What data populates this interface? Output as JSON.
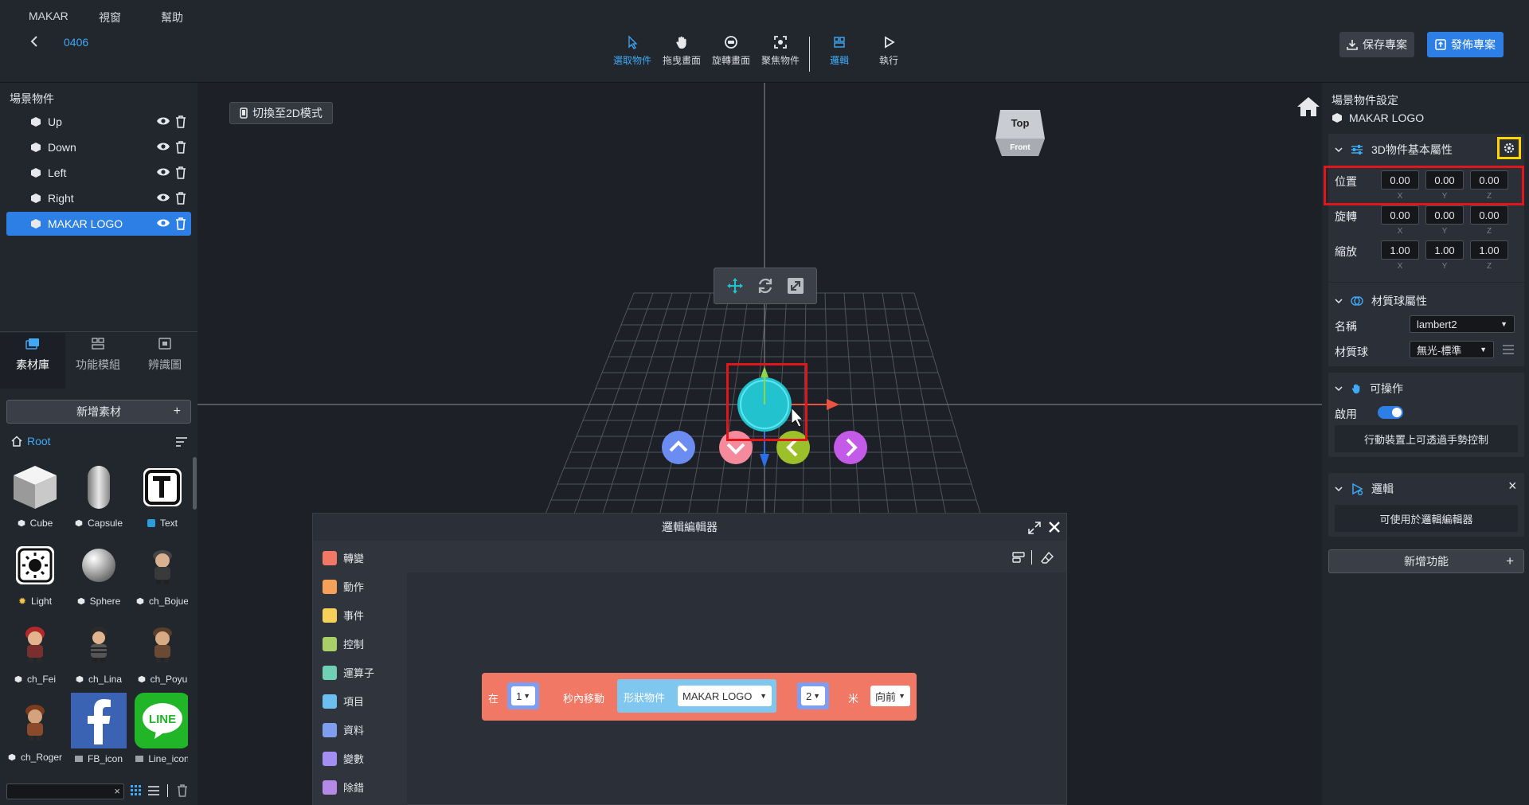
{
  "menu": {
    "app": "MAKAR",
    "window": "視窗",
    "help": "幫助"
  },
  "project": {
    "name": "0406"
  },
  "toolbar": {
    "tools": [
      {
        "label": "選取物件",
        "icon": "cursor-icon",
        "active": true
      },
      {
        "label": "拖曳畫面",
        "icon": "hand-icon",
        "active": false
      },
      {
        "label": "旋轉畫面",
        "icon": "rotate-view-icon",
        "active": false
      },
      {
        "label": "聚焦物件",
        "icon": "focus-icon",
        "active": false
      },
      {
        "label": "邏輯",
        "icon": "logic-icon",
        "active": true
      },
      {
        "label": "執行",
        "icon": "play-icon",
        "active": false
      }
    ],
    "save_label": "保存專案",
    "publish_label": "發佈專案"
  },
  "scene": {
    "title": "場景物件",
    "items": [
      {
        "label": "Up",
        "selected": false
      },
      {
        "label": "Down",
        "selected": false
      },
      {
        "label": "Left",
        "selected": false
      },
      {
        "label": "Right",
        "selected": false
      },
      {
        "label": "MAKAR LOGO",
        "selected": true
      }
    ]
  },
  "library": {
    "tabs": [
      {
        "label": "素材庫",
        "active": true
      },
      {
        "label": "功能模組",
        "active": false
      },
      {
        "label": "辨識圖",
        "active": false
      }
    ],
    "add_label": "新增素材",
    "add_symbol": "+",
    "root_label": "Root",
    "search_clear": "×",
    "assets": [
      {
        "label": "Cube"
      },
      {
        "label": "Capsule"
      },
      {
        "label": "Text"
      },
      {
        "label": "Light"
      },
      {
        "label": "Sphere"
      },
      {
        "label": "ch_Bojue"
      },
      {
        "label": "ch_Fei"
      },
      {
        "label": "ch_Lina"
      },
      {
        "label": "ch_Poyu"
      },
      {
        "label": "ch_Roger"
      },
      {
        "label": "FB_icon"
      },
      {
        "label": "Line_icon"
      }
    ]
  },
  "viewport": {
    "mode_button": "切換至2D模式",
    "gizmo_top": "Top",
    "gizmo_front": "Front"
  },
  "logic_editor": {
    "title": "邏輯編輯器",
    "categories": [
      {
        "label": "轉變",
        "color": "#f07865"
      },
      {
        "label": "動作",
        "color": "#f5a15a"
      },
      {
        "label": "事件",
        "color": "#f7d05a"
      },
      {
        "label": "控制",
        "color": "#a9cf68"
      },
      {
        "label": "運算子",
        "color": "#6fd0b4"
      },
      {
        "label": "項目",
        "color": "#6cc0f0"
      },
      {
        "label": "資料",
        "color": "#7f9ef0"
      },
      {
        "label": "變數",
        "color": "#a48ef2"
      },
      {
        "label": "除錯",
        "color": "#b58ae6"
      }
    ],
    "block": {
      "prefix": "在",
      "duration": "1",
      "move_label": "秒內移動",
      "shape_label": "形狀物件",
      "object": "MAKAR LOGO",
      "distance": "2",
      "unit": "米",
      "direction": "向前"
    }
  },
  "properties": {
    "title": "場景物件設定",
    "object_name": "MAKAR LOGO",
    "basic": {
      "title": "3D物件基本屬性",
      "rows": [
        {
          "label": "位置",
          "x": "0.00",
          "y": "0.00",
          "z": "0.00"
        },
        {
          "label": "旋轉",
          "x": "0.00",
          "y": "0.00",
          "z": "0.00"
        },
        {
          "label": "縮放",
          "x": "1.00",
          "y": "1.00",
          "z": "1.00"
        }
      ],
      "axes": [
        "X",
        "Y",
        "Z"
      ]
    },
    "material": {
      "title": "材質球屬性",
      "name_label": "名稱",
      "name_value": "lambert2",
      "ball_label": "材質球",
      "ball_value": "無光-標準"
    },
    "interactive": {
      "title": "可操作",
      "enable_label": "啟用",
      "enabled": true,
      "note": "行動裝置上可透過手勢控制"
    },
    "logic": {
      "title": "邏輯",
      "close": "×",
      "note": "可使用於邏輯編輯器"
    },
    "add_feature": "新增功能",
    "add_symbol": "+"
  },
  "colors": {
    "accent": "#2d7fe6",
    "highlight_red": "#e0161b",
    "highlight_yellow": "#ffd400",
    "block": "#f07865"
  }
}
